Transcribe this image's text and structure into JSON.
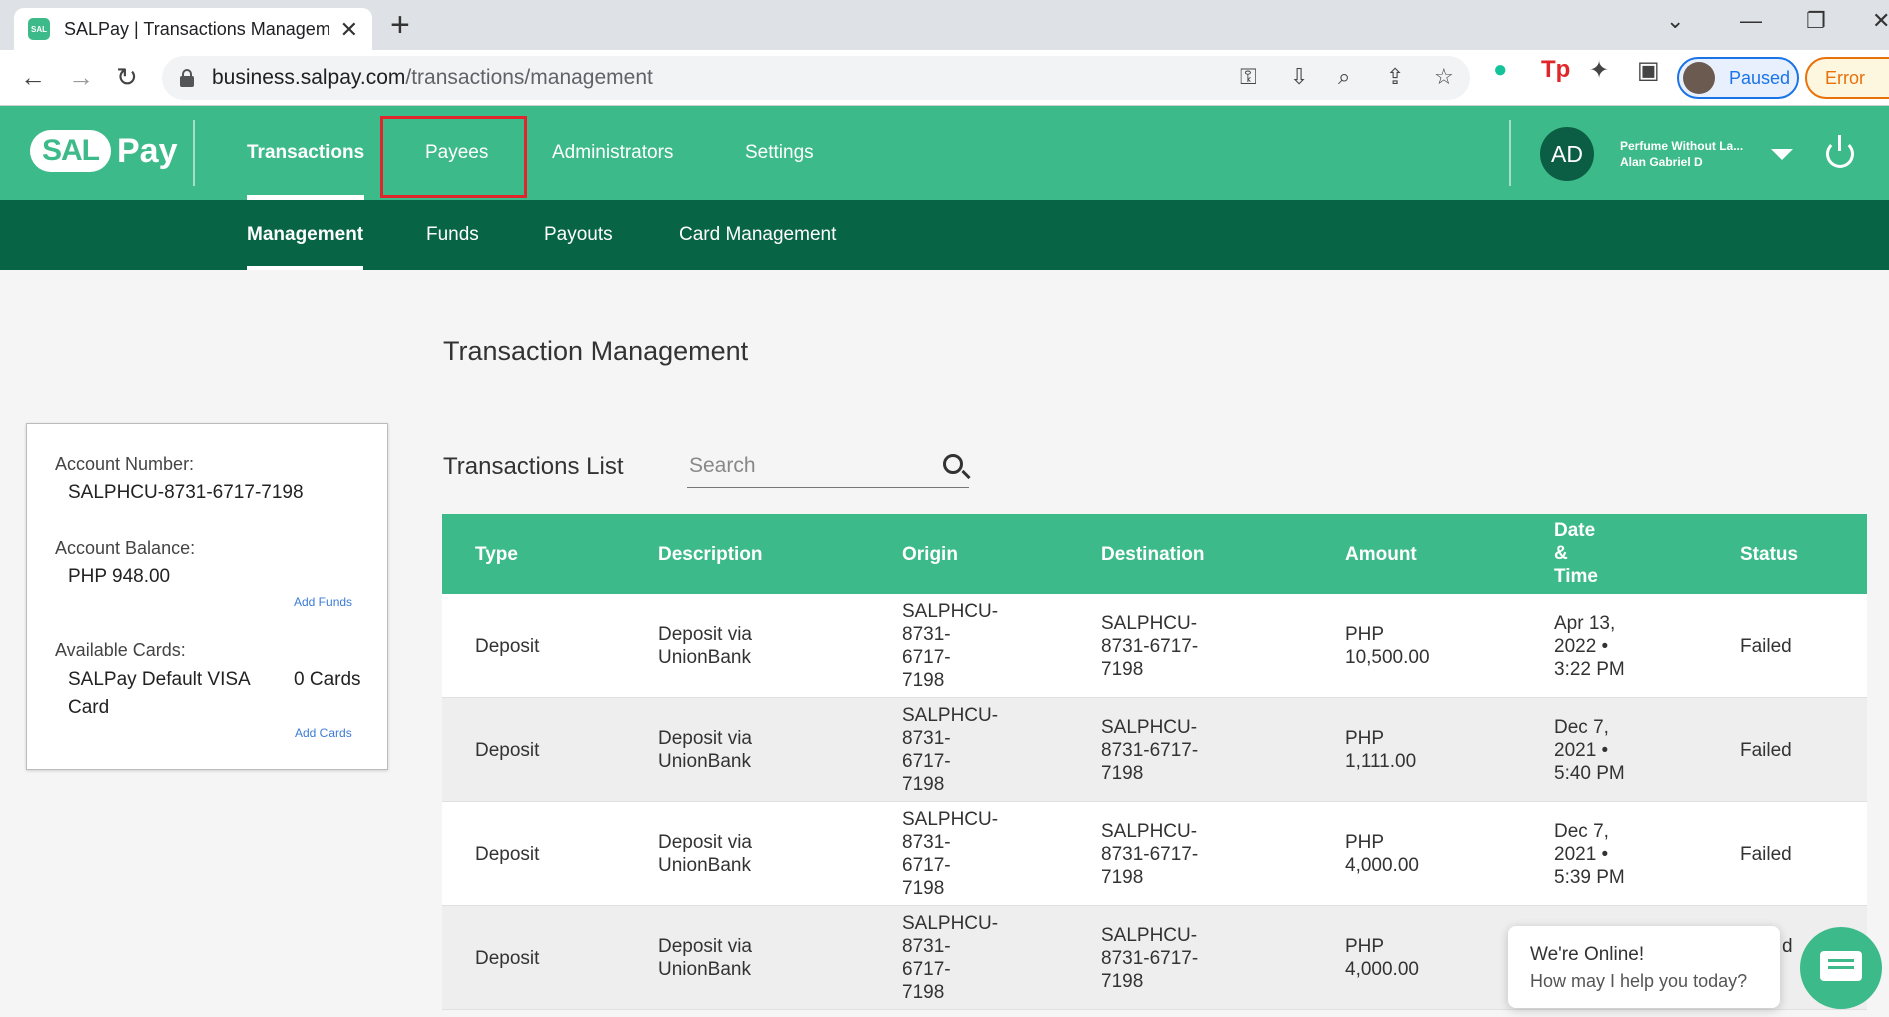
{
  "browser": {
    "tab_title": "SALPay | Transactions Management",
    "favicon_text": "SAL",
    "url_host": "business.salpay.com",
    "url_path": "/transactions/management",
    "profile_label": "Paused",
    "error_label": "Error"
  },
  "header": {
    "logo_sal": "SAL",
    "logo_pay": "Pay",
    "nav": [
      "Transactions",
      "Payees",
      "Administrators",
      "Settings"
    ],
    "avatar_initials": "AD",
    "user_company": "Perfume Without La...",
    "user_name": "Alan Gabriel D",
    "subnav": [
      "Management",
      "Funds",
      "Payouts",
      "Card Management"
    ]
  },
  "page": {
    "title": "Transaction Management",
    "list_title": "Transactions List",
    "search_placeholder": "Search"
  },
  "account": {
    "number_label": "Account Number:",
    "number": "SALPHCU-8731-6717-7198",
    "balance_label": "Account Balance:",
    "balance": "PHP 948.00",
    "add_funds": "Add Funds",
    "cards_label": "Available Cards:",
    "card_name_1": "SALPay Default VISA",
    "card_name_2": "Card",
    "card_count": "0 Cards",
    "add_cards": "Add Cards"
  },
  "table": {
    "headers": {
      "type": "Type",
      "description": "Description",
      "origin": "Origin",
      "destination": "Destination",
      "amount": "Amount",
      "datetime_1": "Date",
      "datetime_2": "&",
      "datetime_3": "Time",
      "status": "Status"
    },
    "rows": [
      {
        "type": "Deposit",
        "desc1": "Deposit via",
        "desc2": "UnionBank",
        "o1": "SALPHCU-",
        "o2": "8731-",
        "o3": "6717-",
        "o4": "7198",
        "d1": "SALPHCU-",
        "d2": "8731-6717-",
        "d3": "7198",
        "a1": "PHP",
        "a2": "10,500.00",
        "t1": "Apr 13,",
        "t2": "2022 •",
        "t3": "3:22 PM",
        "status": "Failed"
      },
      {
        "type": "Deposit",
        "desc1": "Deposit via",
        "desc2": "UnionBank",
        "o1": "SALPHCU-",
        "o2": "8731-",
        "o3": "6717-",
        "o4": "7198",
        "d1": "SALPHCU-",
        "d2": "8731-6717-",
        "d3": "7198",
        "a1": "PHP",
        "a2": "1,111.00",
        "t1": "Dec 7,",
        "t2": "2021 •",
        "t3": "5:40 PM",
        "status": "Failed"
      },
      {
        "type": "Deposit",
        "desc1": "Deposit via",
        "desc2": "UnionBank",
        "o1": "SALPHCU-",
        "o2": "8731-",
        "o3": "6717-",
        "o4": "7198",
        "d1": "SALPHCU-",
        "d2": "8731-6717-",
        "d3": "7198",
        "a1": "PHP",
        "a2": "4,000.00",
        "t1": "Dec 7,",
        "t2": "2021 •",
        "t3": "5:39 PM",
        "status": "Failed"
      },
      {
        "type": "Deposit",
        "desc1": "Deposit via",
        "desc2": "UnionBank",
        "o1": "SALPHCU-",
        "o2": "8731-",
        "o3": "6717-",
        "o4": "7198",
        "d1": "SALPHCU-",
        "d2": "8731-6717-",
        "d3": "7198",
        "a1": "PHP",
        "a2": "4,000.00",
        "t1": "",
        "t2": "",
        "t3": "",
        "status": "d"
      }
    ]
  },
  "chat": {
    "line1": "We're Online!",
    "line2": "How may I help you today?"
  },
  "colors": {
    "brand_green": "#3dba8a",
    "dark_green": "#076444",
    "highlight_red": "#e0262b"
  }
}
